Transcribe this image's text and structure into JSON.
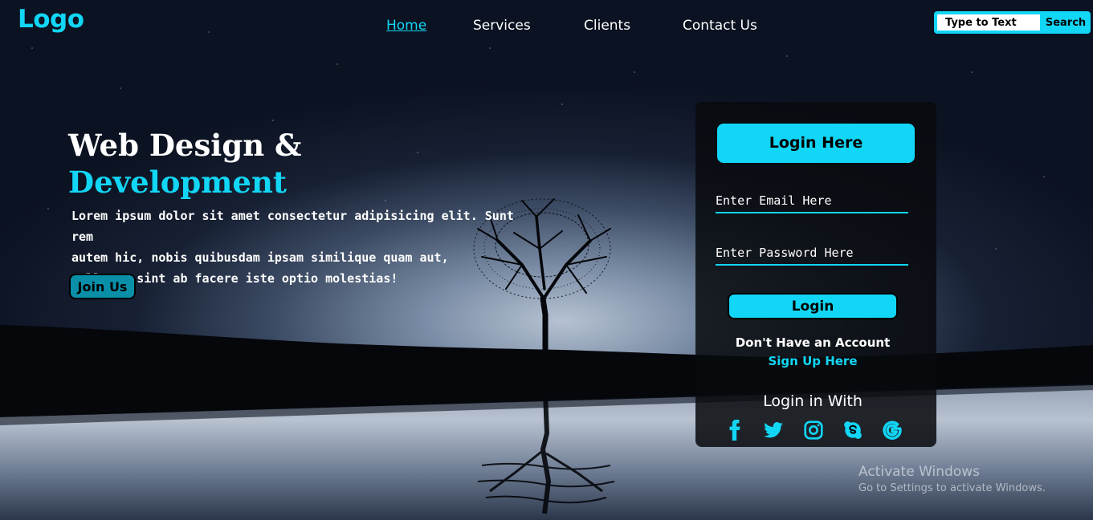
{
  "brand": {
    "logo": "Logo",
    "accent": "#12d6f5"
  },
  "nav": {
    "items": [
      {
        "label": "Home",
        "active": true
      },
      {
        "label": "Services",
        "active": false
      },
      {
        "label": "Clients",
        "active": false
      },
      {
        "label": "Contact Us",
        "active": false
      }
    ]
  },
  "search": {
    "placeholder": "Type to Text",
    "button": "Search"
  },
  "hero": {
    "title_line1": "Web Design &",
    "title_line2": "Development",
    "text_line1": "Lorem ipsum dolor sit amet consectetur adipisicing elit. Sunt rem",
    "text_line2": "autem hic, nobis quibusdam ipsam similique quam aut,",
    "text_line3": "nulla at sint ab facere iste optio molestias!",
    "join_button": "Join Us"
  },
  "login": {
    "heading": "Login Here",
    "email_placeholder": "Enter Email Here",
    "password_placeholder": "Enter Password Here",
    "login_button": "Login",
    "no_account": "Don't Have an Account",
    "signup_link": "Sign Up Here",
    "login_with": "Login in With",
    "social_icons": [
      "facebook-icon",
      "twitter-icon",
      "instagram-icon",
      "skype-icon",
      "google-icon"
    ]
  },
  "watermark": {
    "line1": "Activate Windows",
    "line2": "Go to Settings to activate Windows."
  }
}
